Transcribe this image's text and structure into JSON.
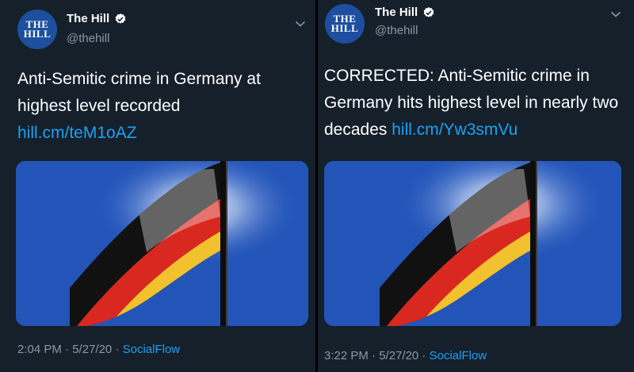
{
  "tweets": [
    {
      "display_name": "The Hill",
      "handle": "@thehill",
      "avatar_line1": "THE",
      "avatar_line2": "HILL",
      "text_plain": "Anti-Semitic crime in Germany at highest level recorded ",
      "link": "hill.cm/teM1oAZ",
      "time": "2:04 PM",
      "date": "5/27/20",
      "source": "SocialFlow"
    },
    {
      "display_name": "The Hill",
      "handle": "@thehill",
      "avatar_line1": "THE",
      "avatar_line2": "HILL",
      "text_plain": "CORRECTED: Anti-Semitic crime in Germany hits highest level in nearly two decades ",
      "link": "hill.cm/Yw3smVu",
      "time": "3:22 PM",
      "date": "5/27/20",
      "source": "SocialFlow"
    }
  ],
  "meta_separator": " · ",
  "icons": {
    "verified": "verified-badge-icon",
    "menu": "chevron-down-icon"
  },
  "colors": {
    "background": "#15202b",
    "link": "#1da1f2",
    "secondary_text": "#8899a6",
    "avatar": "#1d4f9e"
  }
}
